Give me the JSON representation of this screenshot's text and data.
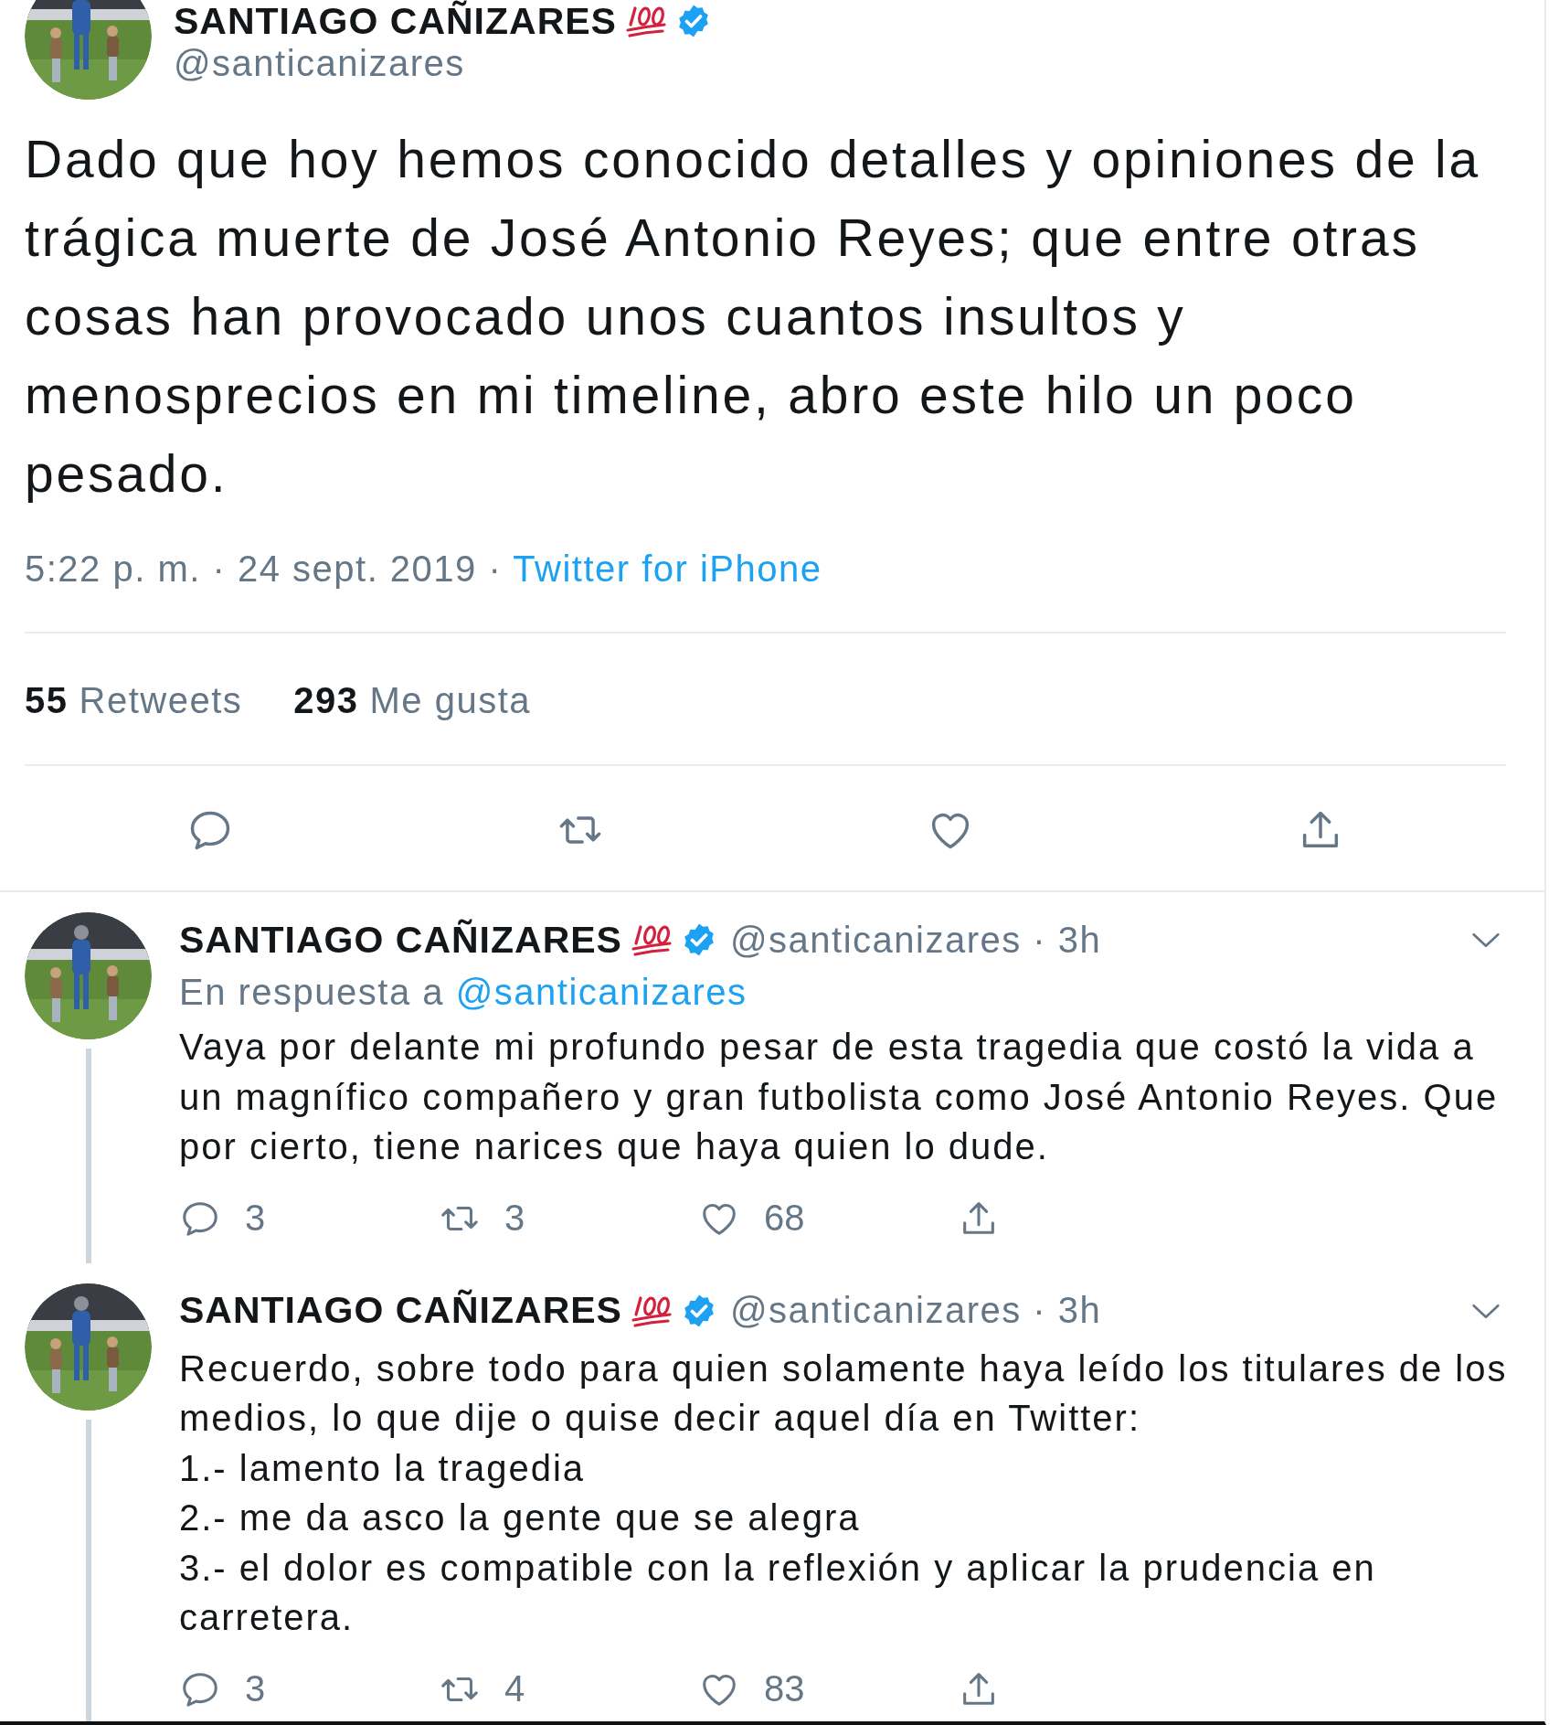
{
  "main_tweet": {
    "author_name": "SANTIAGO CAÑIZARES",
    "handle": "@santicanizares",
    "text": "Dado que hoy hemos conocido detalles y opiniones de la trágica muerte de José Antonio Reyes; que entre otras cosas han provocado unos cuantos insultos y menosprecios en mi timeline, abro este hilo un poco pesado.",
    "timestamp": "5:22 p. m. · 24 sept. 2019 ·",
    "source": "Twitter for iPhone",
    "stats": [
      {
        "count": "55",
        "label": "Retweets"
      },
      {
        "count": "293",
        "label": "Me gusta"
      }
    ]
  },
  "replies": [
    {
      "author_name": "SANTIAGO CAÑIZARES",
      "meta": "@santicanizares · 3h",
      "in_reply_to": {
        "prefix": "En respuesta a",
        "handle": "@santicanizares"
      },
      "text": "Vaya por delante mi profundo pesar de esta tragedia que costó la vida a un magnífico compañero y gran futbolista como José Antonio Reyes. Que por cierto, tiene narices que haya quien lo dude.",
      "counts": {
        "replies": "3",
        "retweets": "3",
        "likes": "68"
      }
    },
    {
      "author_name": "SANTIAGO CAÑIZARES",
      "meta": "@santicanizares · 3h",
      "text": "Recuerdo, sobre todo para quien solamente haya leído los titulares de los medios, lo que dije o quise decir aquel día en Twitter:\n1.- lamento la tragedia\n2.- me da asco la gente que se alegra\n3.- el dolor es compatible con la reflexión y aplicar la prudencia en carretera.",
      "counts": {
        "replies": "3",
        "retweets": "4",
        "likes": "83"
      }
    }
  ]
}
